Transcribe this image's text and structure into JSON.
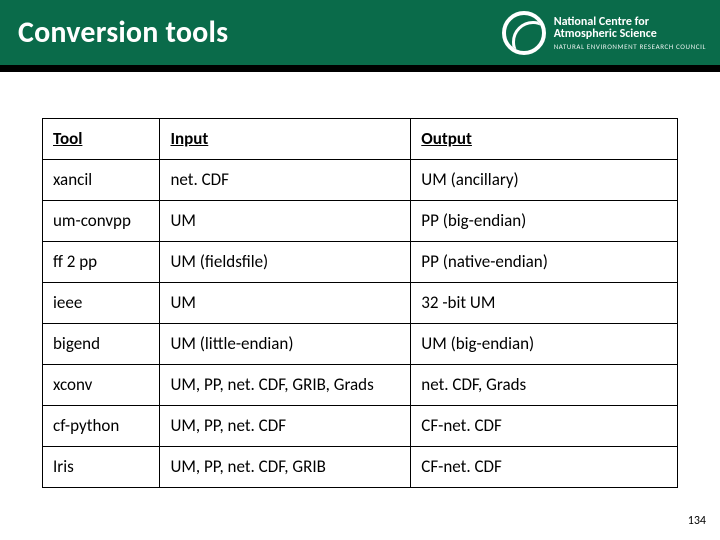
{
  "header": {
    "title": "Conversion tools",
    "logo": {
      "org_line1": "National Centre for",
      "org_line2": "Atmospheric Science",
      "tagline": "NATURAL ENVIRONMENT RESEARCH COUNCIL"
    }
  },
  "table": {
    "headers": [
      "Tool",
      "Input",
      "Output"
    ],
    "rows": [
      [
        "xancil",
        "net. CDF",
        "UM (ancillary)"
      ],
      [
        "um-convpp",
        "UM",
        "PP (big-endian)"
      ],
      [
        "ff 2 pp",
        "UM (fieldsfile)",
        "PP (native-endian)"
      ],
      [
        "ieee",
        "UM",
        "32 -bit UM"
      ],
      [
        "bigend",
        "UM (little-endian)",
        "UM (big-endian)"
      ],
      [
        "xconv",
        "UM, PP, net. CDF, GRIB, Grads",
        "net. CDF, Grads"
      ],
      [
        "cf-python",
        "UM, PP, net. CDF",
        "CF-net. CDF"
      ],
      [
        "Iris",
        "UM, PP, net. CDF, GRIB",
        "CF-net. CDF"
      ]
    ]
  },
  "page_number": "134"
}
